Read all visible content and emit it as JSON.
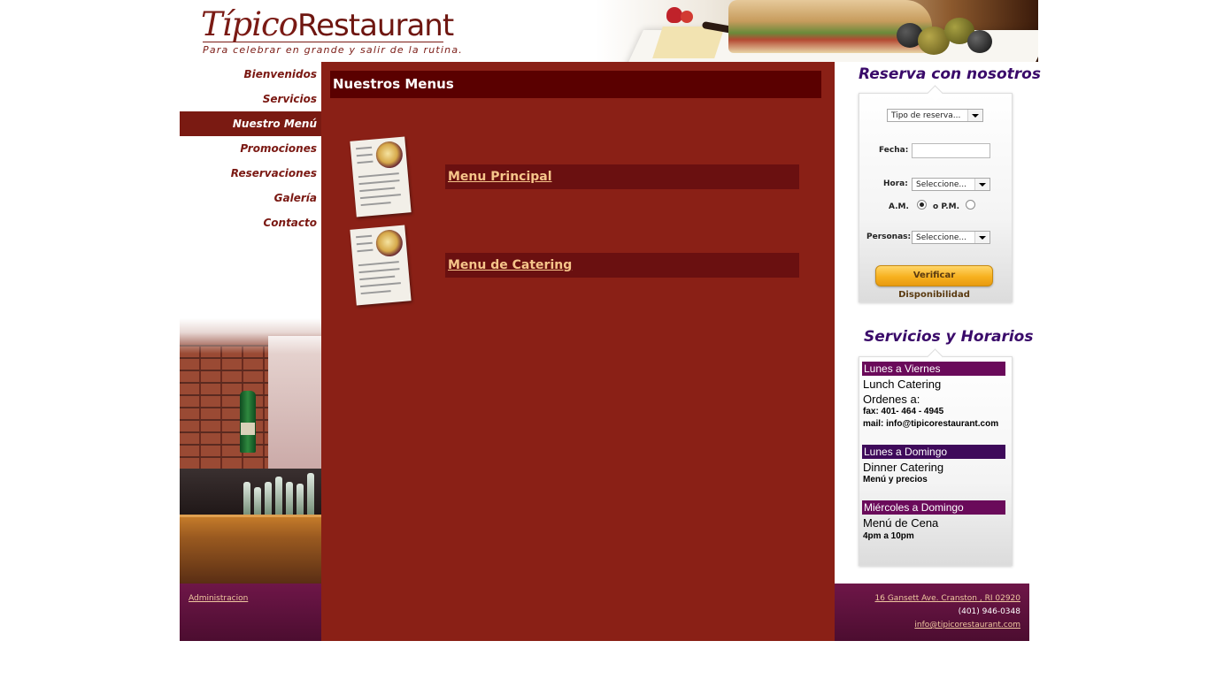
{
  "header": {
    "brand_italic": "Típico",
    "brand_main": "Restaurant",
    "tagline": "Para celebrar en grande y salir de la rutina."
  },
  "nav": {
    "items": [
      {
        "label": "Bienvenidos"
      },
      {
        "label": "Servicios"
      },
      {
        "label": "Nuestro Menú",
        "active": true
      },
      {
        "label": "Promociones"
      },
      {
        "label": "Reservaciones"
      },
      {
        "label": "Galería"
      },
      {
        "label": "Contacto"
      }
    ]
  },
  "main": {
    "title": "Nuestros Menus",
    "menus": [
      {
        "label": "Menu Principal"
      },
      {
        "label": "Menu de Catering"
      }
    ]
  },
  "reserve": {
    "heading": "Reserva con nosotros",
    "type_select": "Tipo de reserva...",
    "fecha_label": "Fecha:",
    "fecha_value": "",
    "hora_label": "Hora:",
    "hora_select": "Seleccione...",
    "am_label": "A.M.",
    "pm_label": "o P.M.",
    "am_checked": true,
    "personas_label": "Personas:",
    "personas_select": "Seleccione...",
    "button": "Verificar Disponibilidad"
  },
  "services": {
    "heading": "Servicios y Horarios",
    "blocks": [
      {
        "band": "Lunes a Viernes",
        "band_color": "#6a0a5a",
        "line1": "Lunch Catering",
        "line2": "Ordenes a:",
        "line3": "fax: 401- 464 - 4945",
        "line4": "mail: info@tipicorestaurant.com"
      },
      {
        "band": "Lunes a Domingo",
        "band_color": "#3e0a5a",
        "line1": "Dinner Catering",
        "line2": "Menú y precios"
      },
      {
        "band": "Miércoles a Domingo",
        "band_color": "#6a0a5a",
        "line1": "Menú de Cena",
        "line2": "4pm a 10pm"
      }
    ]
  },
  "footer": {
    "admin_link": "Administracion",
    "address": "16 Gansett Ave. Cranston , RI 02920",
    "phone": "(401) 946-0348",
    "email": "info@tipicorestaurant.com"
  },
  "colors": {
    "main_bg": "#8a2016",
    "title_bg": "#5a0000",
    "accent_purple": "#3a0a6a",
    "footer_bg": "#6e1648"
  }
}
